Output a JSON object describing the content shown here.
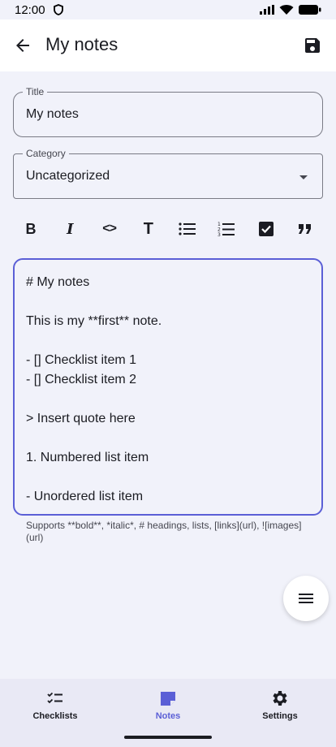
{
  "status_bar": {
    "time": "12:00"
  },
  "header": {
    "title": "My notes"
  },
  "title_field": {
    "label": "Title",
    "value": "My notes"
  },
  "category_field": {
    "label": "Category",
    "value": "Uncategorized"
  },
  "editor": {
    "lines": [
      "# My notes",
      "",
      "This is my **first** note.",
      "",
      "- [] Checklist item 1",
      "- [] Checklist item 2",
      "",
      "> Insert quote here",
      "",
      "1. Numbered list item",
      "",
      "- Unordered list item"
    ]
  },
  "helper_text": "Supports **bold**, *italic*, # headings, lists, [links](url), ![images](url)",
  "toolbar": {
    "bold": "B",
    "italic": "I",
    "code": "<>",
    "text": "T"
  },
  "bottom_nav": {
    "items": [
      {
        "label": "Checklists",
        "icon": "checklist-icon"
      },
      {
        "label": "Notes",
        "icon": "note-icon",
        "active": true
      },
      {
        "label": "Settings",
        "icon": "gear-icon"
      }
    ]
  },
  "colors": {
    "accent": "#5b5fd6",
    "background": "#f1f2fa",
    "nav_background": "#e9e9f5"
  }
}
